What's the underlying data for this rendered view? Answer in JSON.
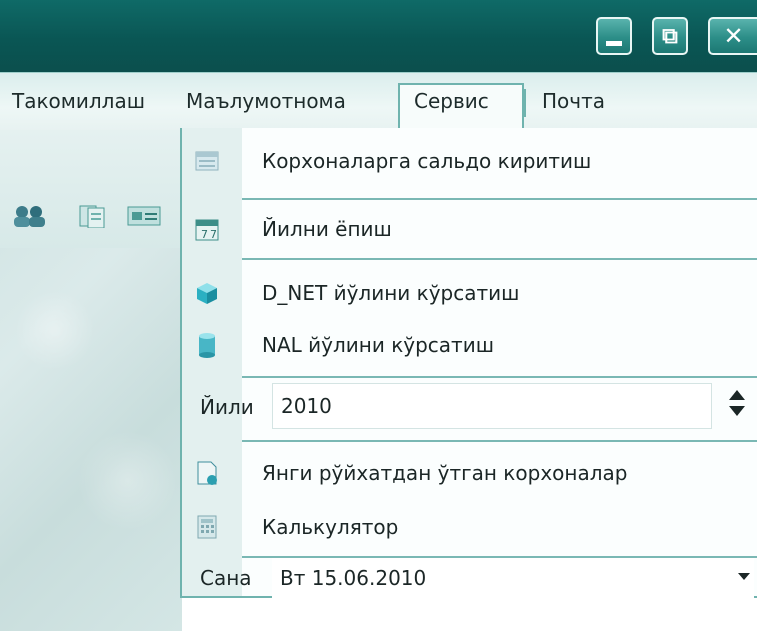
{
  "window": {
    "minimize_label": "_",
    "maximize_label": "⧉",
    "close_label": "✕"
  },
  "menu": {
    "items": [
      {
        "label": "Такомиллаш"
      },
      {
        "label": "Маълумотнома"
      },
      {
        "label": "Сервис"
      },
      {
        "label": "Почта"
      }
    ],
    "active": "Сервис"
  },
  "toolbar": {
    "icons": [
      "users-icon",
      "documents-icon",
      "card-icon"
    ]
  },
  "service_menu": {
    "items": [
      {
        "label": "Корхоналарга сальдо киритиш",
        "icon": "ledger-icon"
      },
      {
        "label": "Йилни ёпиш",
        "icon": "calendar-icon"
      },
      {
        "label": "D_NET йўлини кўрсатиш",
        "icon": "cube-icon"
      },
      {
        "label": "NAL йўлини кўрсатиш",
        "icon": "database-icon"
      },
      {
        "label": "Янги рўйхатдан ўтган корхоналар",
        "icon": "new-document-icon"
      },
      {
        "label": "Калькулятор",
        "icon": "calculator-icon"
      }
    ],
    "year": {
      "label": "Йили",
      "value": "2010"
    },
    "date": {
      "label": "Сана",
      "value": "Вт 15.06.2010"
    }
  },
  "colors": {
    "titlebar": "#0b5654",
    "accent": "#6fb3ae",
    "menu_background": "#eef7f6"
  }
}
